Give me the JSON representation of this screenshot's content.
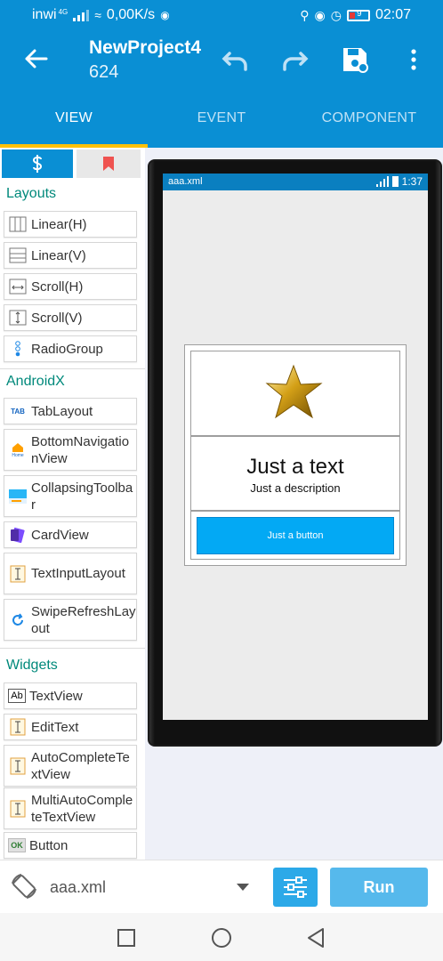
{
  "status_bar": {
    "carrier": "inwi",
    "network": "4G",
    "speed": "0,00K/s",
    "battery": "9",
    "time": "02:07"
  },
  "app_bar": {
    "title": "NewProject4",
    "subtitle": "624"
  },
  "tabs": [
    {
      "label": "VIEW",
      "active": true
    },
    {
      "label": "EVENT",
      "active": false
    },
    {
      "label": "COMPONENT",
      "active": false
    }
  ],
  "palette": {
    "sections": {
      "layouts": "Layouts",
      "androidx": "AndroidX",
      "widgets": "Widgets"
    },
    "layouts": [
      {
        "label": "Linear(H)",
        "icon": "linear-h-icon"
      },
      {
        "label": "Linear(V)",
        "icon": "linear-v-icon"
      },
      {
        "label": "Scroll(H)",
        "icon": "scroll-h-icon"
      },
      {
        "label": "Scroll(V)",
        "icon": "scroll-v-icon"
      },
      {
        "label": "RadioGroup",
        "icon": "radiogroup-icon"
      }
    ],
    "androidx": [
      {
        "label": "TabLayout",
        "icon": "tablayout-icon",
        "badge": "TAB"
      },
      {
        "label": "BottomNavigationView",
        "icon": "bottomnav-icon",
        "badge": "Home"
      },
      {
        "label": "CollapsingToolbar",
        "icon": "collapsing-toolbar-icon"
      },
      {
        "label": "CardView",
        "icon": "cardview-icon"
      },
      {
        "label": "TextInputLayout",
        "icon": "textinput-icon"
      },
      {
        "label": "SwipeRefreshLayout",
        "icon": "swiperefresh-icon"
      }
    ],
    "widgets": [
      {
        "label": "TextView",
        "icon": "textview-icon",
        "badge": "Ab"
      },
      {
        "label": "EditText",
        "icon": "edittext-icon"
      },
      {
        "label": "AutoCompleteTextView",
        "icon": "autocomplete-icon"
      },
      {
        "label": "MultiAutoCompleteTextView",
        "icon": "multiautocomplete-icon"
      },
      {
        "label": "Button",
        "icon": "button-icon",
        "badge": "OK"
      }
    ]
  },
  "preview": {
    "file": "aaa.xml",
    "time": "1:37",
    "heading": "Just a text",
    "description": "Just a description",
    "button_label": "Just a button"
  },
  "bottom_bar": {
    "filename": "aaa.xml",
    "run_label": "Run"
  },
  "colors": {
    "primary": "#0a8fd4",
    "accent": "#ffc107",
    "section": "#00897b",
    "preview_button": "#03a9f4"
  }
}
